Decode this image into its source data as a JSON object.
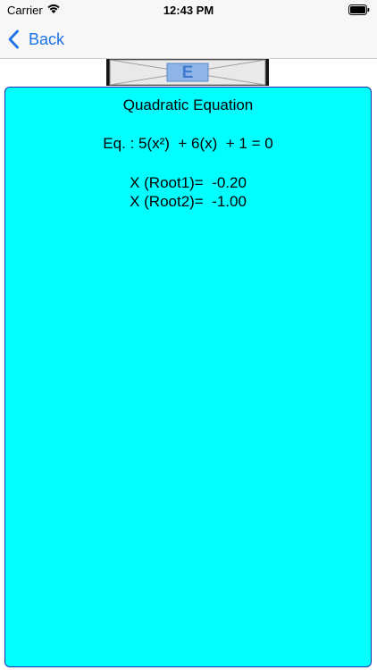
{
  "status_bar": {
    "carrier": "Carrier",
    "time": "12:43 PM",
    "icons": [
      "wifi-icon",
      "battery-icon"
    ]
  },
  "nav": {
    "back_label": "Back",
    "back_icon": "chevron-left-icon",
    "accent_color": "#1a73e8"
  },
  "header": {
    "logo_letter": "E"
  },
  "panel": {
    "background_color": "#00ffff",
    "title": "Quadratic  Equation",
    "equation": "Eq. : 5(x²)  + 6(x)  + 1 = 0",
    "root1": "X (Root1)=  -0.20",
    "root2": "X (Root2)=  -1.00"
  }
}
